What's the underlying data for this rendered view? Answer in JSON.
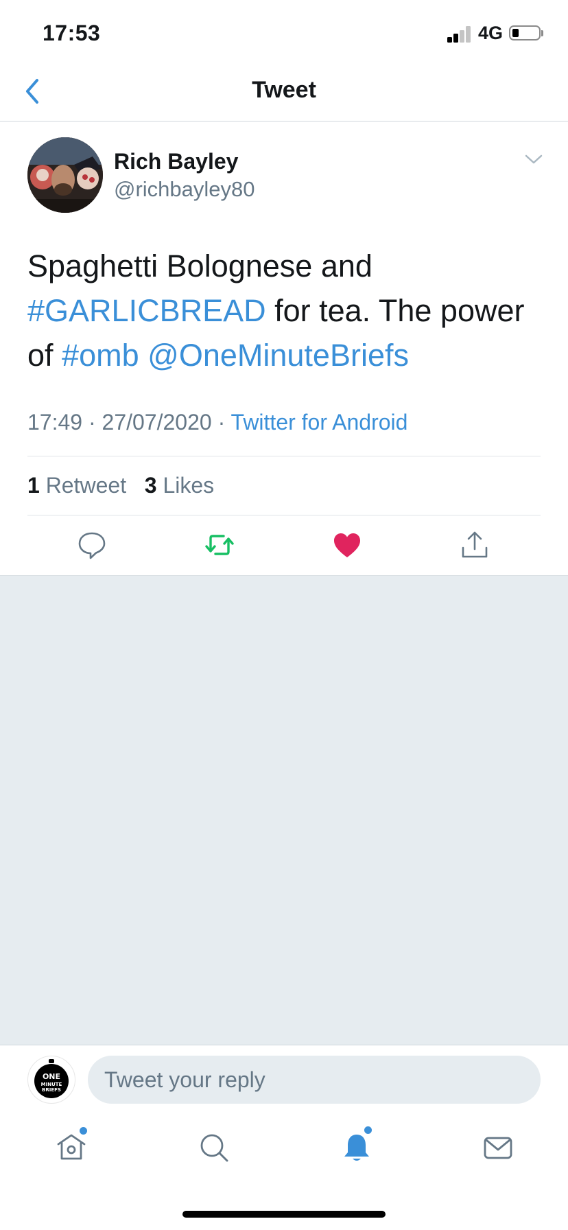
{
  "status_bar": {
    "time": "17:53",
    "network": "4G"
  },
  "nav": {
    "title": "Tweet",
    "back_icon": "chevron-left-icon"
  },
  "tweet": {
    "author_name": "Rich Bayley",
    "author_handle": "@richbayley80",
    "text_parts": {
      "p1": "Spaghetti Bolognese and ",
      "hashtag1": "#GARLICBREAD",
      "p2": " for tea. The power of ",
      "hashtag2": "#omb",
      "space": " ",
      "mention": "@OneMinuteBriefs"
    },
    "time": "17:49",
    "sep": " · ",
    "date": "27/07/2020",
    "source": "Twitter for Android",
    "stats": {
      "retweet_count": "1",
      "retweet_label": "Retweet",
      "likes_count": "3",
      "likes_label": "Likes"
    }
  },
  "actions": {
    "reply_icon": "speech-bubble-icon",
    "retweet_icon": "retweet-icon",
    "like_icon": "heart-icon",
    "share_icon": "share-icon",
    "retweet_color": "#17bf63",
    "like_color": "#e0245e"
  },
  "reply_bar": {
    "placeholder": "Tweet your reply",
    "avatar_logo_lines": [
      "ONE",
      "MINUTE",
      "BRIEFS"
    ]
  },
  "tab_bar": {
    "items": [
      "home-icon",
      "search-icon",
      "notifications-icon",
      "messages-icon"
    ],
    "accent": "#3a8fd8"
  }
}
